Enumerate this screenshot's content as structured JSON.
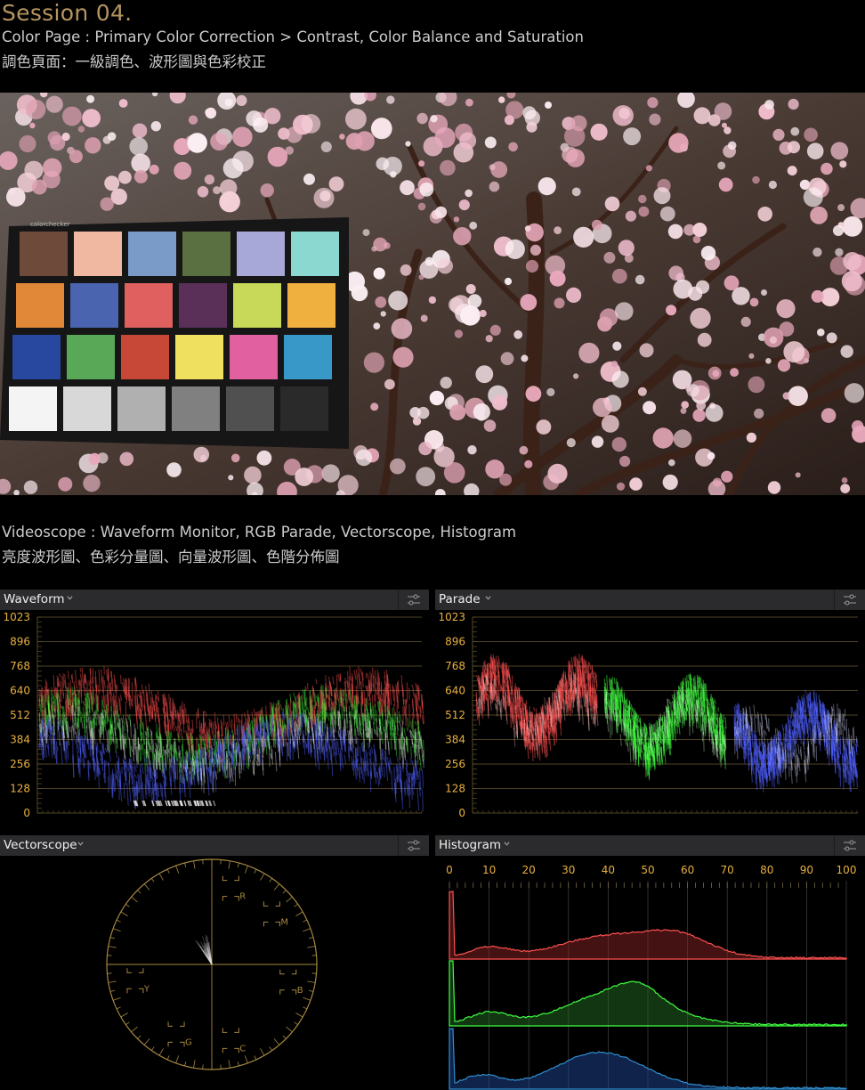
{
  "header": {
    "title": "Session 04.",
    "subtitle_en": "Color Page : Primary Color Correction > Contrast, Color Balance and Saturation",
    "subtitle_zh": "調色頁面：一級調色、波形圖與色彩校正"
  },
  "scopes_header": {
    "title_en": "Videoscope : Waveform Monitor, RGB Parade, Vectorscope, Histogram",
    "title_zh": "亮度波形圖、色彩分量圖、向量波形圖、色階分佈圖"
  },
  "photo": {
    "chart_label": "colorchecker",
    "checker_colors": [
      "#6e4a3a",
      "#f0b8a0",
      "#7a9ac8",
      "#5a7040",
      "#a8a8d8",
      "#8ad8d0",
      "#e08838",
      "#4a64b0",
      "#e06060",
      "#5a3058",
      "#c8d858",
      "#f0b040",
      "#2848a0",
      "#58a858",
      "#c84838",
      "#f0e060",
      "#e060a0",
      "#3898c8",
      "#f4f4f4",
      "#d8d8d8",
      "#b0b0b0",
      "#808080",
      "#505050",
      "#2a2a2a"
    ]
  },
  "panels": {
    "waveform": {
      "title": "Waveform"
    },
    "parade": {
      "title": "Parade"
    },
    "vectorscope": {
      "title": "Vectorscope",
      "targets": [
        "R",
        "M",
        "Y",
        "B",
        "G",
        "C"
      ]
    },
    "histogram": {
      "title": "Histogram"
    }
  },
  "waveform_scale": [
    "1023",
    "896",
    "768",
    "640",
    "512",
    "384",
    "256",
    "128",
    "0"
  ],
  "histogram_scale": [
    "0",
    "10",
    "20",
    "30",
    "40",
    "50",
    "60",
    "70",
    "80",
    "90",
    "100"
  ],
  "colors": {
    "accent": "#b59560",
    "scale_label": "#e8b040",
    "red": "#ff5050",
    "green": "#40ff40",
    "blue": "#5060ff",
    "panel_bar": "#2b2b2e"
  }
}
